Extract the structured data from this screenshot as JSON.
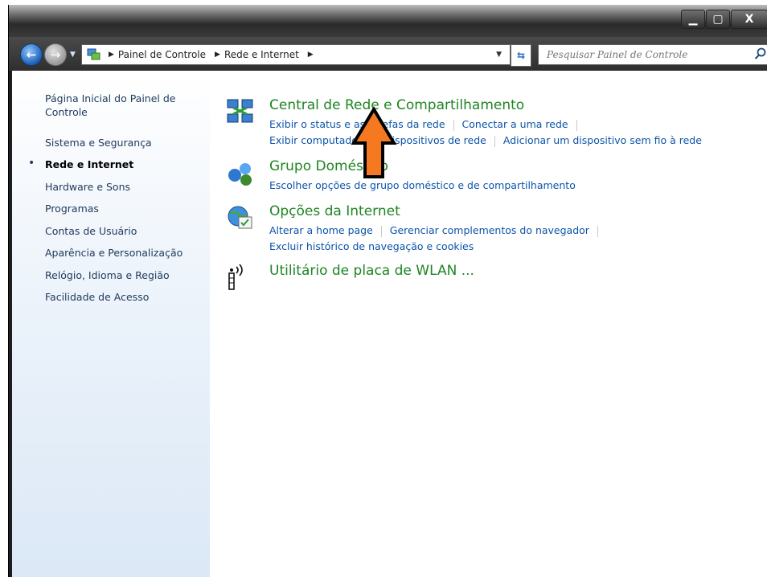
{
  "window": {
    "controls": {
      "minimize": "▁",
      "maximize": "▢",
      "close": "X"
    }
  },
  "address": {
    "crumbs": [
      "Painel de Controle",
      "Rede e Internet"
    ],
    "search_placeholder": "Pesquisar Painel de Controle"
  },
  "sidebar": {
    "items": [
      {
        "label": "Página Inicial do Painel de Controle",
        "active": false
      },
      {
        "label": "Sistema e Segurança",
        "active": false
      },
      {
        "label": "Rede e Internet",
        "active": true
      },
      {
        "label": "Hardware e Sons",
        "active": false
      },
      {
        "label": "Programas",
        "active": false
      },
      {
        "label": "Contas de Usuário",
        "active": false
      },
      {
        "label": "Aparência e Personalização",
        "active": false
      },
      {
        "label": "Relógio, Idioma e Região",
        "active": false
      },
      {
        "label": "Facilidade de Acesso",
        "active": false
      }
    ]
  },
  "categories": [
    {
      "title": "Central de Rede e Compartilhamento",
      "icon": "network-sharing-icon",
      "links": [
        [
          "Exibir o status e as tarefas da rede",
          "Conectar a uma rede"
        ],
        [
          "Exibir computadores e dispositivos de rede",
          "Adicionar um dispositivo sem fio à rede"
        ]
      ]
    },
    {
      "title": "Grupo Doméstico",
      "icon": "homegroup-icon",
      "links": [
        [
          "Escolher opções de grupo doméstico e de compartilhamento"
        ]
      ]
    },
    {
      "title": "Opções da Internet",
      "icon": "internet-options-icon",
      "links": [
        [
          "Alterar a home page",
          "Gerenciar complementos do navegador"
        ],
        [
          "Excluir histórico de navegação e cookies"
        ]
      ]
    },
    {
      "title": "Utilitário de placa de WLAN ...",
      "icon": "wlan-icon",
      "links": []
    }
  ],
  "colors": {
    "category_title": "#1e8522",
    "link": "#0b54a8",
    "annotation_arrow": "#f47920"
  }
}
